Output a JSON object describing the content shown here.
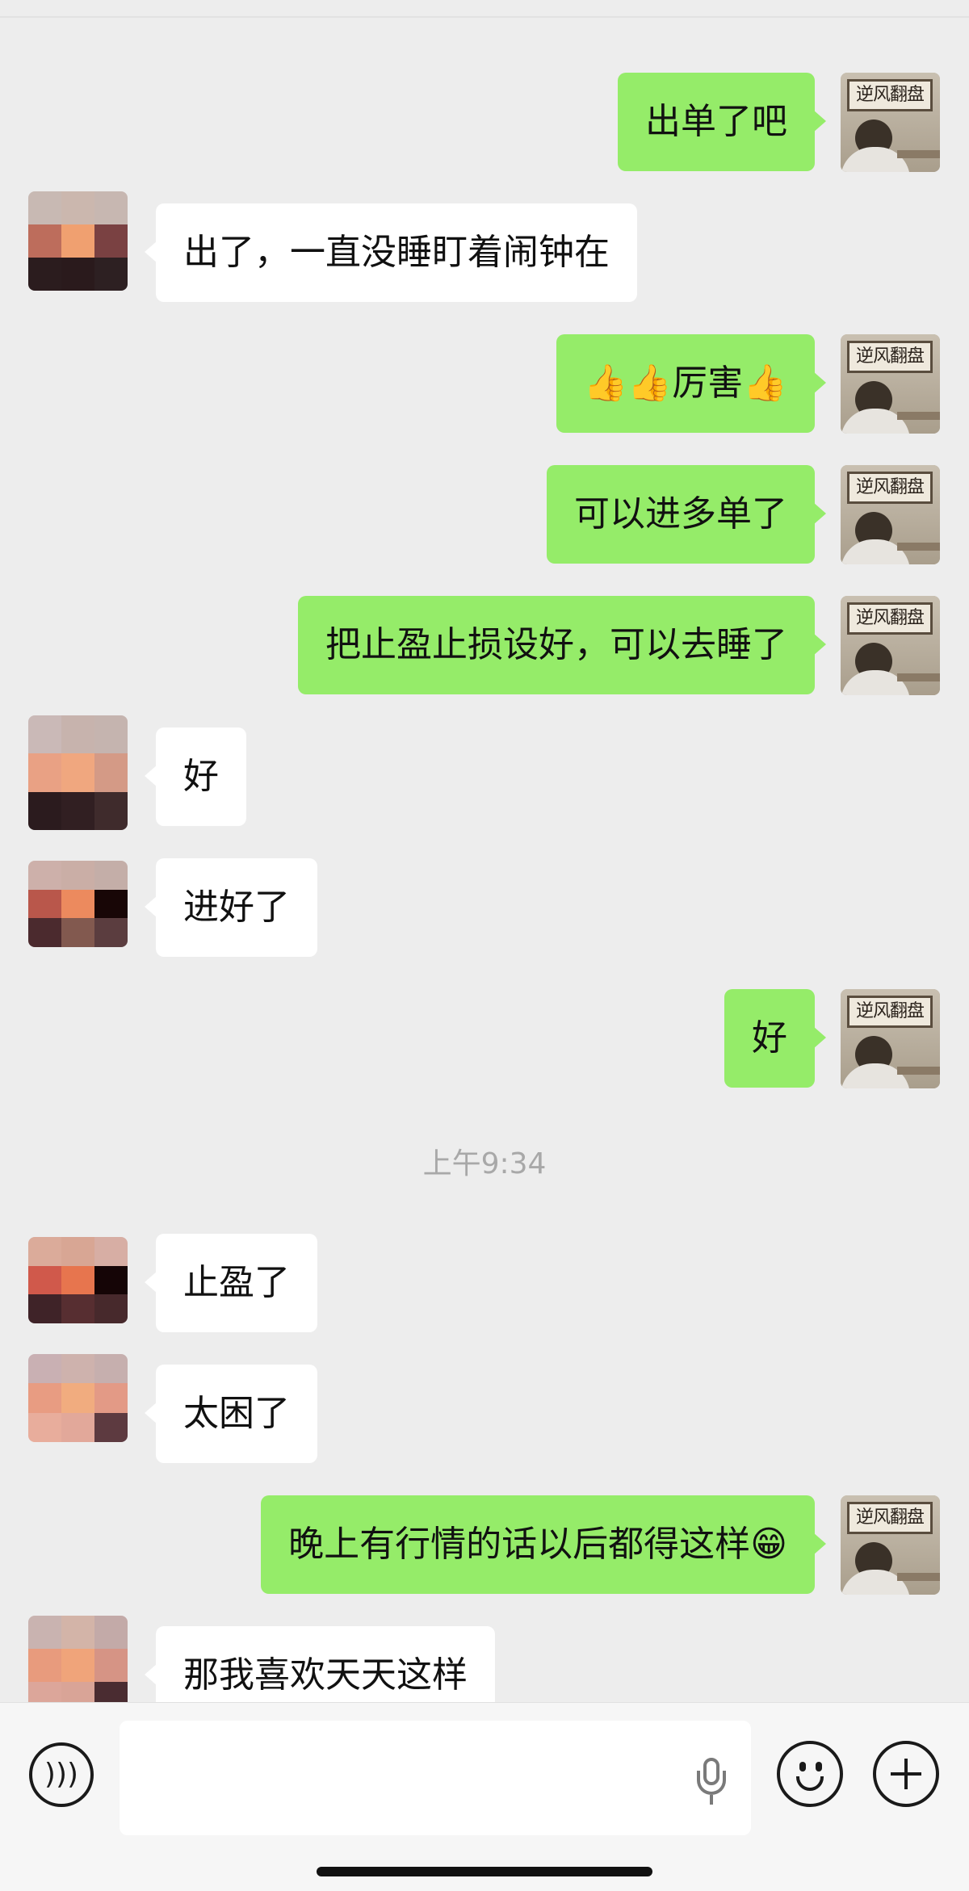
{
  "my_avatar_text": "逆风翻盘",
  "messages": [
    {
      "from": "me",
      "text": "出单了吧"
    },
    {
      "from": "other",
      "text": "出了，一直没睡盯着闹钟在"
    },
    {
      "from": "me",
      "text": "👍👍厉害👍"
    },
    {
      "from": "me",
      "text": "可以进多单了"
    },
    {
      "from": "me",
      "text": "把止盈止损设好，可以去睡了"
    },
    {
      "from": "other",
      "text": "好"
    },
    {
      "from": "other",
      "text": "进好了"
    },
    {
      "from": "me",
      "text": "好"
    },
    {
      "from": "other",
      "text": "止盈了"
    },
    {
      "from": "other",
      "text": "太困了"
    },
    {
      "from": "me",
      "text": "晚上有行情的话以后都得这样😁"
    },
    {
      "from": "other",
      "text": "那我喜欢天天这样"
    }
  ],
  "timestamp": "上午9:34",
  "icons": [
    "voice-icon",
    "microphone-icon",
    "emoji-icon",
    "plus-icon"
  ],
  "colors": {
    "my_bubble": "#95ec69",
    "other_bubble": "#ffffff",
    "background": "#ededed"
  }
}
